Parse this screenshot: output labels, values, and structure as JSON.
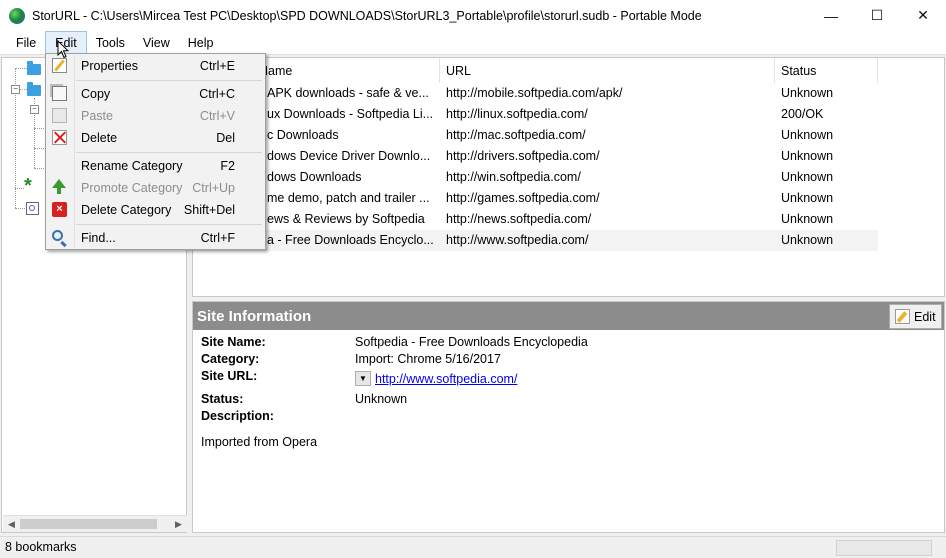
{
  "window": {
    "title": "StorURL - C:\\Users\\Mircea Test PC\\Desktop\\SPD DOWNLOADS\\StorURL3_Portable\\profile\\storurl.sudb - Portable Mode",
    "minimize": "—",
    "maximize": "☐",
    "close": "✕"
  },
  "menubar": {
    "items": [
      {
        "label": "File"
      },
      {
        "label": "Edit"
      },
      {
        "label": "Tools"
      },
      {
        "label": "View"
      },
      {
        "label": "Help"
      }
    ]
  },
  "edit_menu": {
    "items": [
      {
        "label": "Properties",
        "shortcut": "Ctrl+E",
        "icon": "properties-icon",
        "enabled": true
      },
      {
        "label": "Copy",
        "shortcut": "Ctrl+C",
        "icon": "copy-icon",
        "enabled": true
      },
      {
        "label": "Paste",
        "shortcut": "Ctrl+V",
        "icon": "paste-icon",
        "enabled": false
      },
      {
        "label": "Delete",
        "shortcut": "Del",
        "icon": "delete-icon",
        "enabled": true
      },
      {
        "label": "Rename Category",
        "shortcut": "F2",
        "icon": "",
        "enabled": true
      },
      {
        "label": "Promote Category",
        "shortcut": "Ctrl+Up",
        "icon": "green-up-arrow-icon",
        "enabled": false
      },
      {
        "label": "Delete Category",
        "shortcut": "Shift+Del",
        "icon": "red-x-icon",
        "enabled": true
      },
      {
        "label": "Find...",
        "shortcut": "Ctrl+F",
        "icon": "magnifier-icon",
        "enabled": true
      }
    ]
  },
  "list": {
    "columns": [
      "Name",
      "URL",
      "Status"
    ],
    "rows": [
      {
        "name": "APK downloads - safe & ve...",
        "url": "http://mobile.softpedia.com/apk/",
        "status": "Unknown"
      },
      {
        "name": "ux Downloads - Softpedia Li...",
        "url": "http://linux.softpedia.com/",
        "status": "200/OK"
      },
      {
        "name": "c Downloads",
        "url": "http://mac.softpedia.com/",
        "status": "Unknown"
      },
      {
        "name": "dows Device Driver Downlo...",
        "url": "http://drivers.softpedia.com/",
        "status": "Unknown"
      },
      {
        "name": "dows Downloads",
        "url": "http://win.softpedia.com/",
        "status": "Unknown"
      },
      {
        "name": "me demo, patch and trailer ...",
        "url": "http://games.softpedia.com/",
        "status": "Unknown"
      },
      {
        "name": "ews & Reviews by Softpedia",
        "url": "http://news.softpedia.com/",
        "status": "Unknown"
      },
      {
        "name": "a - Free Downloads Encyclo...",
        "url": "http://www.softpedia.com/",
        "status": "Unknown"
      }
    ],
    "selected_row": 7
  },
  "site_info": {
    "header": "Site Information",
    "edit_label": "Edit",
    "site_name_label": "Site Name:",
    "site_name": "Softpedia - Free Downloads Encyclopedia",
    "category_label": "Category:",
    "category": "Import: Chrome 5/16/2017",
    "site_url_label": "Site URL:",
    "site_url": "http://www.softpedia.com/",
    "status_label": "Status:",
    "status": "Unknown",
    "description_label": "Description:",
    "description": "Imported from Opera"
  },
  "statusbar": {
    "text": "8 bookmarks"
  },
  "colors": {
    "folder": "#3ca0e0",
    "info_header": "#8c8c8c",
    "link": "#0000ee"
  }
}
